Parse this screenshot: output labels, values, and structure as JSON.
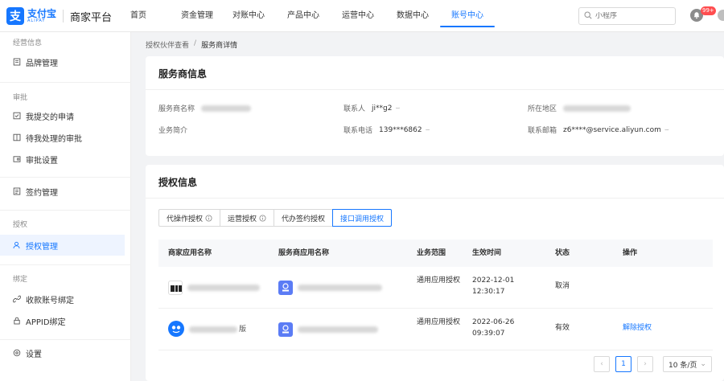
{
  "logo": {
    "mark": "支",
    "zh": "支付宝",
    "en": "ALIPAY",
    "platform": "商家平台"
  },
  "nav": [
    "首页",
    "资金管理",
    "对账中心",
    "产品中心",
    "运营中心",
    "数据中心",
    "账号中心"
  ],
  "nav_active": "账号中心",
  "search": {
    "placeholder": "小程序"
  },
  "notifications": {
    "badge": "99+"
  },
  "sidebar": {
    "group_merchant_info": "经营信息",
    "brand": "品牌管理",
    "group_approval": "审批",
    "my_requests": "我提交的申请",
    "pending_approvals": "待我处理的审批",
    "approval_settings": "审批设置",
    "signing": "签约管理",
    "group_auth": "授权",
    "auth_mgmt": "授权管理",
    "group_binding": "绑定",
    "payee_binding": "收款账号绑定",
    "appid_binding": "APPID绑定",
    "settings": "设置"
  },
  "breadcrumb": {
    "parent": "授权伙伴查看",
    "sep": "/",
    "current": "服务商详情"
  },
  "provider": {
    "title": "服务商信息",
    "name_label": "服务商名称",
    "contact_label": "联系人",
    "contact_value": "ji**g2",
    "region_label": "所在地区",
    "intro_label": "业务简介",
    "phone_label": "联系电话",
    "phone_value": "139***6862",
    "email_label": "联系邮箱",
    "email_value": "z6****@service.aliyun.com",
    "toggle_icon": "⌣"
  },
  "auth": {
    "title": "授权信息",
    "tabs": [
      "代操作授权",
      "运营授权",
      "代办签约授权",
      "接口调用授权"
    ],
    "active_tab": "接口调用授权",
    "columns": [
      "商家应用名称",
      "服务商应用名称",
      "业务范围",
      "生效时间",
      "状态",
      "操作"
    ],
    "rows": [
      {
        "merchant_app_suffix": "",
        "scope": "通用应用授权",
        "time_date": "2022-12-01",
        "time_clock": "12:30:17",
        "status": "取消",
        "action": ""
      },
      {
        "merchant_app_suffix": "版",
        "scope": "通用应用授权",
        "time_date": "2022-06-26",
        "time_clock": "09:39:07",
        "status": "有效",
        "action": "解除授权"
      }
    ]
  },
  "pagination": {
    "prev": "‹",
    "page": "1",
    "next": "›",
    "page_size": "10 条/页"
  },
  "colors": {
    "accent": "#1677ff",
    "badge": "#ff4d4f"
  }
}
